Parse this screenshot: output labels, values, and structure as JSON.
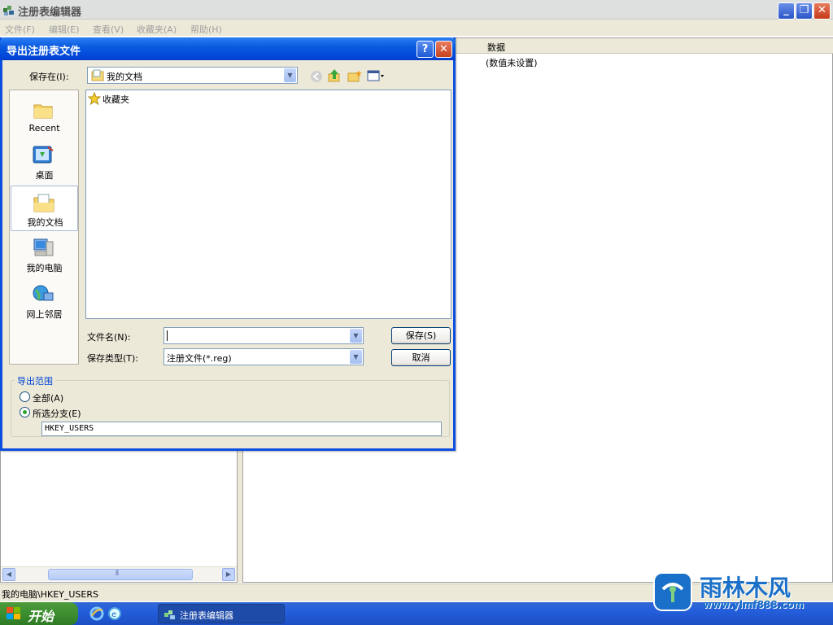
{
  "app": {
    "title": "注册表编辑器",
    "menus": [
      "文件(F)",
      "编辑(E)",
      "查看(V)",
      "收藏夹(A)",
      "帮助(H)"
    ],
    "data_column_header": "数据",
    "data_value": "(数值未设置)",
    "status_path": "我的电脑\\HKEY_USERS",
    "hscroll_thumb_glyph": "⦀"
  },
  "taskbar": {
    "start_label": "开始",
    "task_label": "注册表编辑器"
  },
  "dialog": {
    "title": "导出注册表文件",
    "help_glyph": "?",
    "close_glyph": "✕",
    "save_in_label": "保存在(I):",
    "save_in_value": "我的文档",
    "places": [
      {
        "label": "Recent",
        "icon": "recent-icon"
      },
      {
        "label": "桌面",
        "icon": "desktop-icon"
      },
      {
        "label": "我的文档",
        "icon": "my-documents-icon"
      },
      {
        "label": "我的电脑",
        "icon": "my-computer-icon"
      },
      {
        "label": "网上邻居",
        "icon": "network-places-icon"
      }
    ],
    "files": [
      {
        "name": "收藏夹",
        "icon": "favorites-star-icon"
      }
    ],
    "filename_label": "文件名(N):",
    "filename_value": "",
    "filetype_label": "保存类型(T):",
    "filetype_value": "注册文件(*.reg)",
    "save_button": "保存(S)",
    "cancel_button": "取消",
    "export_range_label": "导出范围",
    "radio_all": "全部(A)",
    "radio_selected": "所选分支(E)",
    "selected_radio": "radio_selected",
    "branch_value": "HKEY_USERS"
  },
  "watermark": {
    "brand": "雨林木风",
    "url": "www.ylmf888.com"
  },
  "colors": {
    "dialog_title": "#0a5be0",
    "taskbar": "#245edb",
    "start": "#3c8e30",
    "watermark_blue": "#1a6fc8"
  }
}
